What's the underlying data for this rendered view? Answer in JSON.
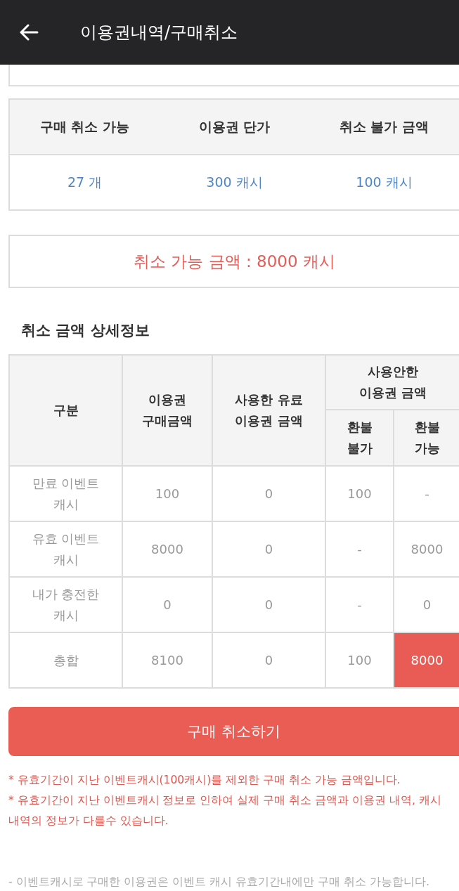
{
  "header": {
    "title": "이용권내역/구매취소"
  },
  "summary": {
    "columns": [
      {
        "heading": "구매 취소 가능",
        "value": "27 개"
      },
      {
        "heading": "이용권 단가",
        "value": "300 캐시"
      },
      {
        "heading": "취소 불가 금액",
        "value": "100 캐시"
      }
    ]
  },
  "cancel_amount": "취소 가능 금액 : 8000 캐시",
  "detail": {
    "title": "취소 금액 상세정보",
    "header_rows": [
      [
        {
          "text": "구분",
          "rowspan": 2
        },
        {
          "text": "이용권 구매금액",
          "rowspan": 2
        },
        {
          "text": "사용한 유료 이용권 금액",
          "rowspan": 2
        },
        {
          "text": "사용안한 이용권 금액",
          "colspan": 2
        }
      ],
      [
        {
          "text": "환불 불가"
        },
        {
          "text": "환불 가능"
        }
      ]
    ],
    "rows": [
      {
        "cells": [
          {
            "text": "만료 이벤트 캐시",
            "highlighted": false
          },
          {
            "text": "100",
            "highlighted": false
          },
          {
            "text": "0",
            "highlighted": false
          },
          {
            "text": "100",
            "highlighted": false
          },
          {
            "text": "-",
            "highlighted": false
          }
        ]
      },
      {
        "cells": [
          {
            "text": "유효 이벤트 캐시",
            "highlighted": false
          },
          {
            "text": "8000",
            "highlighted": false
          },
          {
            "text": "0",
            "highlighted": false
          },
          {
            "text": "-",
            "highlighted": false
          },
          {
            "text": "8000",
            "highlighted": false
          }
        ]
      },
      {
        "cells": [
          {
            "text": "내가 충전한 캐시",
            "highlighted": false
          },
          {
            "text": "0",
            "highlighted": false
          },
          {
            "text": "0",
            "highlighted": false
          },
          {
            "text": "-",
            "highlighted": false
          },
          {
            "text": "0",
            "highlighted": false
          }
        ]
      },
      {
        "cells": [
          {
            "text": "총합",
            "highlighted": false
          },
          {
            "text": "8100",
            "highlighted": false
          },
          {
            "text": "0",
            "highlighted": false
          },
          {
            "text": "100",
            "highlighted": false
          },
          {
            "text": "8000",
            "highlighted": true
          }
        ]
      }
    ]
  },
  "cancel_button": {
    "label": "구매 취소하기"
  },
  "notes": [
    "* 유효기간이 지난 이벤트캐시(100캐시)를 제외한 구매 취소 가능 금액입니다.",
    "* 유효기간이 지난 이벤트캐시 정보로 인하여 실제 구매 취소 금액과 이용권 내역, 캐시 내역의 정보가 다를수 있습니다."
  ],
  "footer_note": "- 이벤트캐시로 구매한 이용권은 이벤트 캐시 유효기간내에만 구매 취소 가능합니다."
}
